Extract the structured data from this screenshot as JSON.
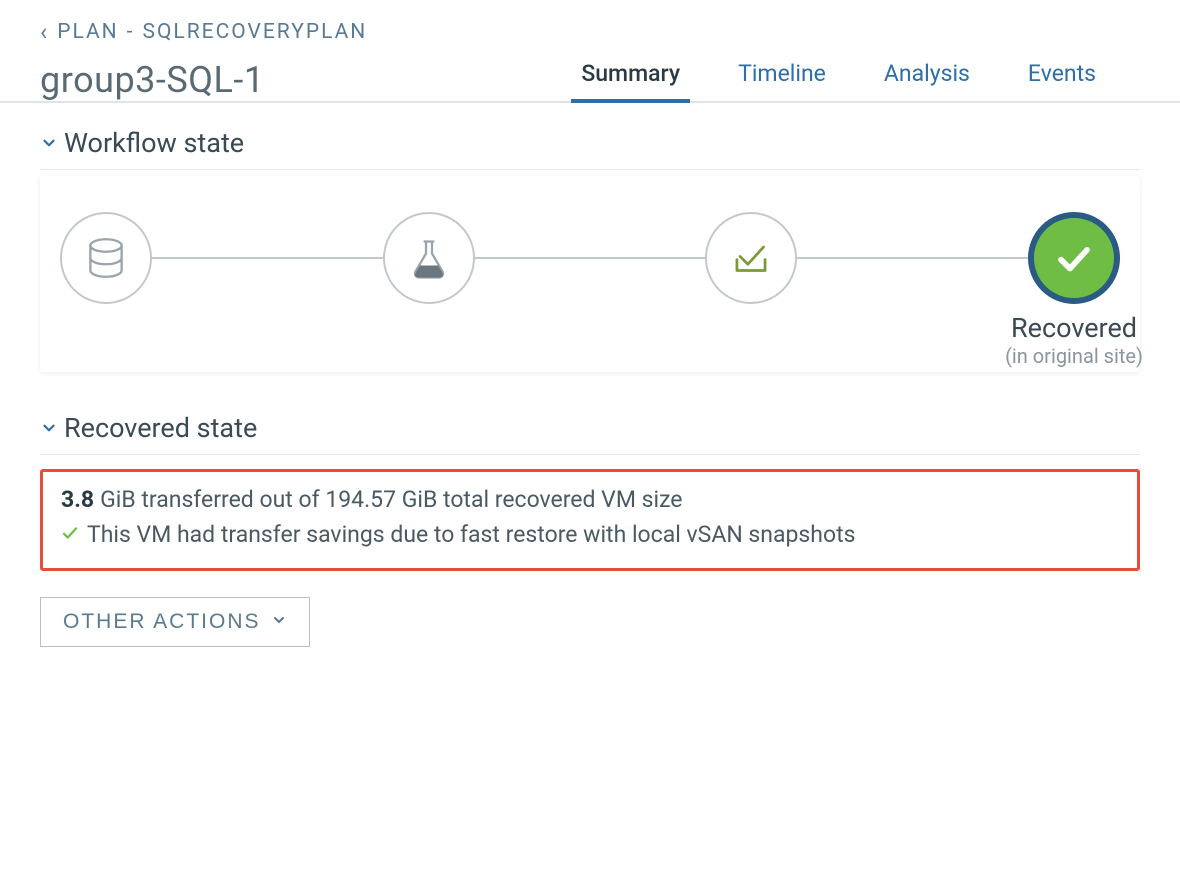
{
  "breadcrumb": {
    "prefix": "PLAN",
    "separator": "-",
    "name": "SQLRECOVERYPLAN"
  },
  "title": "group3-SQL-1",
  "tabs": [
    {
      "label": "Summary",
      "active": true
    },
    {
      "label": "Timeline",
      "active": false
    },
    {
      "label": "Analysis",
      "active": false
    },
    {
      "label": "Events",
      "active": false
    }
  ],
  "workflow": {
    "heading": "Workflow state",
    "final_label": "Recovered",
    "final_sublabel": "(in original site)",
    "step_icons": [
      "database-icon",
      "flask-icon",
      "checkbox-icon",
      "checkmark-filled-icon"
    ]
  },
  "recovered": {
    "heading": "Recovered state",
    "transferred_value": "3.8",
    "transferred_rest": "GiB transferred out of 194.57 GiB total recovered VM size",
    "savings_text": "This VM had transfer savings due to fast restore with local vSAN snapshots"
  },
  "actions": {
    "other_label": "OTHER ACTIONS"
  }
}
